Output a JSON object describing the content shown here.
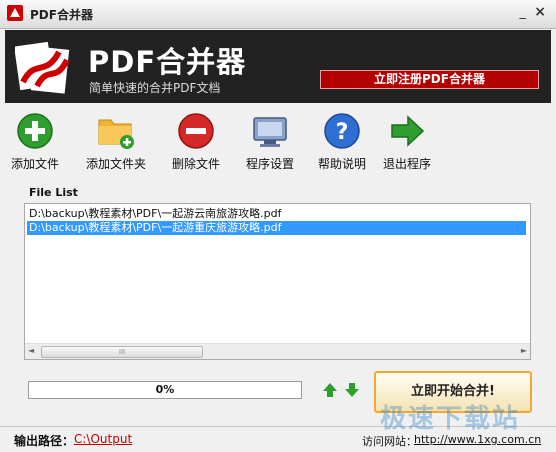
{
  "window": {
    "title": "PDF合并器",
    "minimize_glyph": "_",
    "close_glyph": "×"
  },
  "banner": {
    "product_name": "PDF合并器",
    "tagline": "简单快速的合并PDF文档",
    "register_button": "立即注册PDF合并器"
  },
  "toolbar": {
    "items": [
      {
        "label": "添加文件",
        "icon": "green-plus-icon"
      },
      {
        "label": "添加文件夹",
        "icon": "folder-add-icon"
      },
      {
        "label": "删除文件",
        "icon": "red-minus-icon"
      },
      {
        "label": "程序设置",
        "icon": "monitor-settings-icon"
      },
      {
        "label": "帮助说明",
        "icon": "help-question-icon"
      },
      {
        "label": "退出程序",
        "icon": "exit-arrow-icon"
      }
    ]
  },
  "file_list": {
    "caption": "File List",
    "rows": [
      {
        "text": "D:\\backup\\教程素材\\PDF\\一起游云南旅游攻略.pdf",
        "selected": false
      },
      {
        "text": "D:\\backup\\教程素材\\PDF\\一起游重庆旅游攻略.pdf",
        "selected": true
      }
    ],
    "scroll_thumb_grip": "III"
  },
  "progress": {
    "value": 0,
    "label": "0%"
  },
  "start_button": "立即开始合并!",
  "status": {
    "output_label": "输出路径：",
    "output_path": "C:\\Output",
    "site_label": "访问网站：",
    "site_url": "http://www.1xg.com.cn"
  },
  "watermark": "极速下载站",
  "colors": {
    "banner_bg": "#222222",
    "register_bg": "#b30000",
    "selection": "#3399ff",
    "start_border": "#f0a830",
    "progress_fill": "#2f9a3a"
  }
}
